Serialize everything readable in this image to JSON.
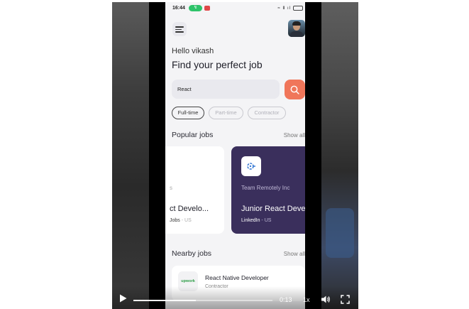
{
  "status_bar": {
    "time": "16:44",
    "indicator": "↯",
    "icons": "≈ Ⅱ ıl",
    "battery": "□"
  },
  "app": {
    "greeting": "Hello vikash",
    "headline": "Find your perfect job",
    "search": {
      "value": "React"
    },
    "filters": [
      "Full-time",
      "Part-time",
      "Contractor"
    ],
    "popular": {
      "title": "Popular jobs",
      "show_all": "Show all",
      "cards": [
        {
          "company_fragment": "s",
          "title": "ct Develo...",
          "source": "Jobs",
          "location": "- US"
        },
        {
          "company": "Team Remotely Inc",
          "title": "Junior React Deve",
          "source": "LinkedIn",
          "location": "- US"
        }
      ]
    },
    "nearby": {
      "title": "Nearby jobs",
      "show_all": "Show all",
      "items": [
        {
          "logo_text": "upwork",
          "title": "React Native Developer",
          "type": "Contractor"
        }
      ]
    }
  },
  "player": {
    "time": "0:13",
    "speed": "1x",
    "progress": 0.45
  },
  "colors": {
    "accent": "#f0765a",
    "card_dark": "#3a2f5c",
    "status_pill": "#2ec36a"
  }
}
